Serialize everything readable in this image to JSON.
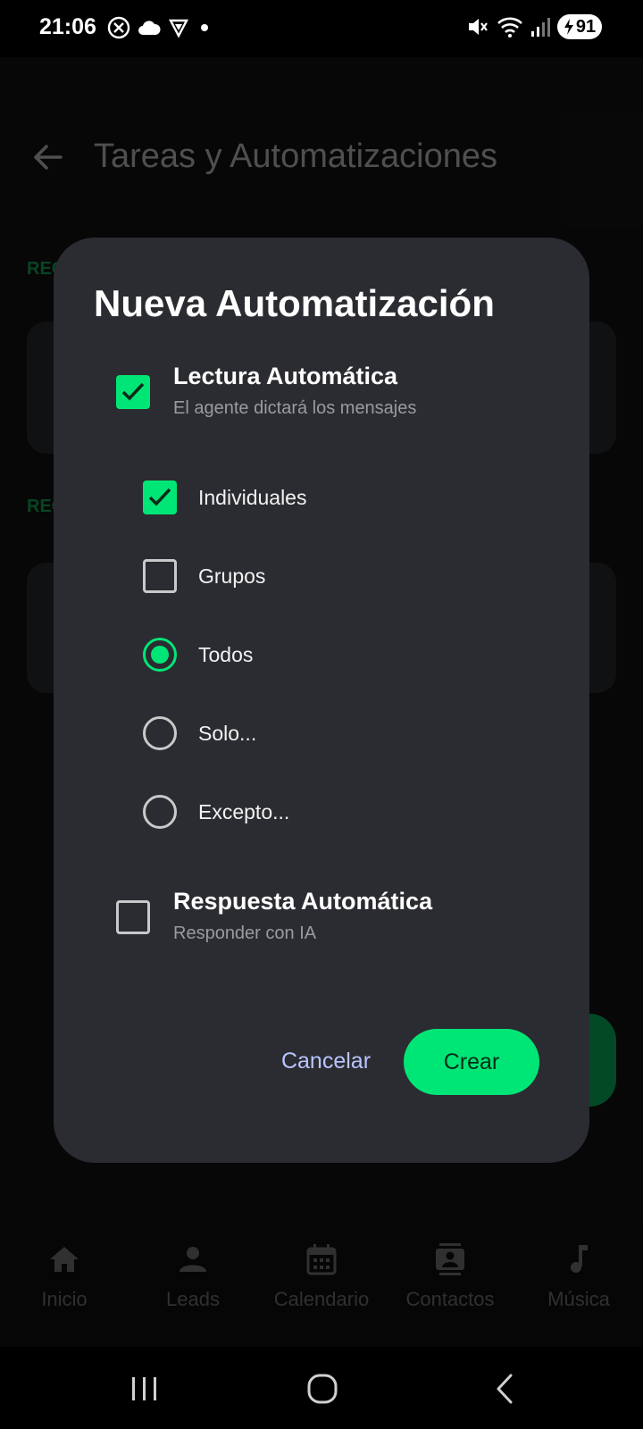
{
  "status_bar": {
    "time": "21:06",
    "battery": "91",
    "left_icons": [
      "x-circle-icon",
      "cloud-icon",
      "shield-icon",
      "dot-icon"
    ],
    "right_icons": [
      "mute-icon",
      "wifi-icon",
      "signal-icon",
      "battery-charging-icon"
    ]
  },
  "app_bar": {
    "title": "Tareas y Automatizaciones"
  },
  "background": {
    "section_1_label": "REG",
    "section_2_label": "REG"
  },
  "dialog": {
    "title": "Nueva Automatización",
    "auto_read": {
      "label": "Lectura Automática",
      "sublabel": "El agente dictará los mensajes",
      "checked": true
    },
    "individuales": {
      "label": "Individuales",
      "checked": true
    },
    "grupos": {
      "label": "Grupos",
      "checked": false
    },
    "scope_options": [
      {
        "label": "Todos",
        "selected": true
      },
      {
        "label": "Solo...",
        "selected": false
      },
      {
        "label": "Excepto...",
        "selected": false
      }
    ],
    "auto_reply": {
      "label": "Respuesta Automática",
      "sublabel": "Responder con IA",
      "checked": false
    },
    "cancel_label": "Cancelar",
    "create_label": "Crear"
  },
  "bottom_nav": [
    {
      "label": "Inicio",
      "icon": "home-icon"
    },
    {
      "label": "Leads",
      "icon": "person-icon"
    },
    {
      "label": "Calendario",
      "icon": "calendar-icon"
    },
    {
      "label": "Contactos",
      "icon": "contacts-icon"
    },
    {
      "label": "Música",
      "icon": "music-note-icon"
    }
  ],
  "colors": {
    "accent": "#00e676",
    "dialog_bg": "#2b2c31",
    "cancel_text": "#b9c5ff"
  }
}
